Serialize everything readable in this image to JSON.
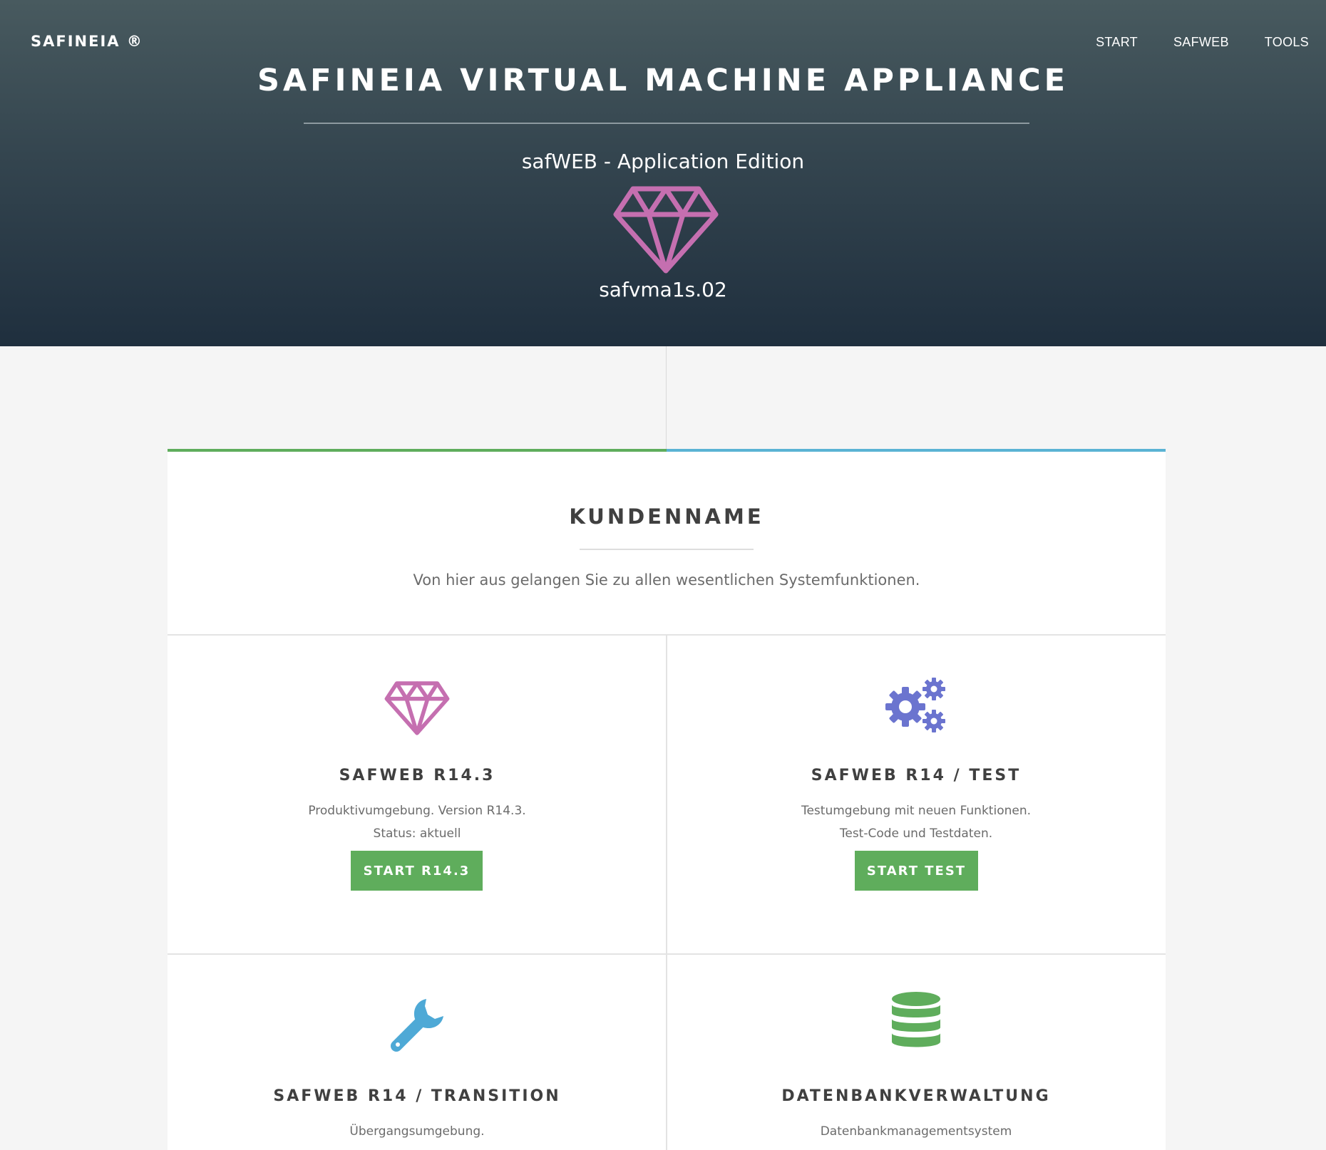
{
  "header": {
    "brand": "SAFINEIA ®",
    "nav": [
      "START",
      "SAFWEB",
      "TOOLS"
    ],
    "title": "SAFINEIA VIRTUAL MACHINE APPLIANCE",
    "subtitle": "safWEB - Application Edition",
    "hostname": "safvma1s.02",
    "icon": "diamond-icon"
  },
  "customer": {
    "title": "KUNDENNAME",
    "description": "Von hier aus gelangen Sie zu allen wesentlichen Systemfunktionen."
  },
  "tiles": [
    {
      "icon": "diamond-icon",
      "title": "SAFWEB R14.3",
      "line1": "Produktivumgebung. Version R14.3.",
      "line2": "Status: aktuell",
      "button": "START R14.3"
    },
    {
      "icon": "gears-icon",
      "title": "SAFWEB R14 / TEST",
      "line1": "Testumgebung mit neuen Funktionen.",
      "line2": "Test-Code und Testdaten.",
      "button": "START TEST"
    },
    {
      "icon": "wrench-icon",
      "title": "SAFWEB R14 / TRANSITION",
      "line1": "Übergangsumgebung."
    },
    {
      "icon": "database-icon",
      "title": "DATENBANKVERWALTUNG",
      "line1": "Datenbankmanagementsystem"
    }
  ],
  "colors": {
    "accent_green": "#5fad5c",
    "accent_blue": "#5ab3d4",
    "diamond": "#c56fb0",
    "gears": "#6b74cf",
    "wrench": "#4ea9d6",
    "database": "#5fad5c"
  }
}
